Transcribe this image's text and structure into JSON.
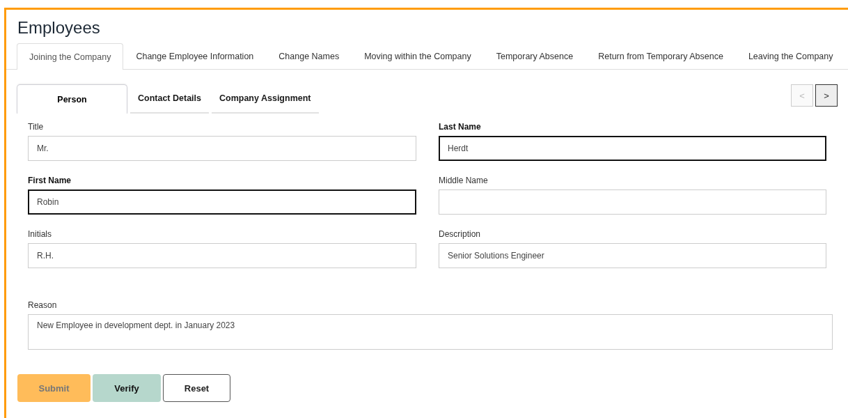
{
  "page": {
    "title": "Employees"
  },
  "tabs": [
    {
      "label": "Joining the Company",
      "selected": true
    },
    {
      "label": "Change Employee Information",
      "selected": false
    },
    {
      "label": "Change Names",
      "selected": false
    },
    {
      "label": "Moving within the Company",
      "selected": false
    },
    {
      "label": "Temporary Absence",
      "selected": false
    },
    {
      "label": "Return from Temporary Absence",
      "selected": false
    },
    {
      "label": "Leaving the Company",
      "selected": false
    }
  ],
  "subtabs": [
    {
      "label": "Person",
      "selected": true
    },
    {
      "label": "Contact Details",
      "selected": false
    },
    {
      "label": "Company Assignment",
      "selected": false
    }
  ],
  "pager": [
    {
      "label": "<",
      "disabled": true
    },
    {
      "label": ">",
      "disabled": false
    }
  ],
  "fields": [
    {
      "label": "Title",
      "value": "Mr.",
      "required": false
    },
    {
      "label": "Last Name",
      "value": "Herdt",
      "required": true
    },
    {
      "label": "First Name",
      "value": "Robin",
      "required": true
    },
    {
      "label": "Middle Name",
      "required": false
    },
    {
      "label": "Initials",
      "value": "R.H.",
      "required": false
    },
    {
      "label": "Description",
      "value": "Senior Solutions Engineer",
      "required": false
    }
  ],
  "reason": {
    "label": "Reason",
    "value": "New Employee in development dept. in January 2023"
  },
  "buttons": [
    {
      "label": "Submit",
      "kind": "primary",
      "disabled": true
    },
    {
      "label": "Verify",
      "kind": "secondary",
      "disabled": false
    },
    {
      "label": "Reset",
      "kind": "outline",
      "disabled": false
    }
  ]
}
